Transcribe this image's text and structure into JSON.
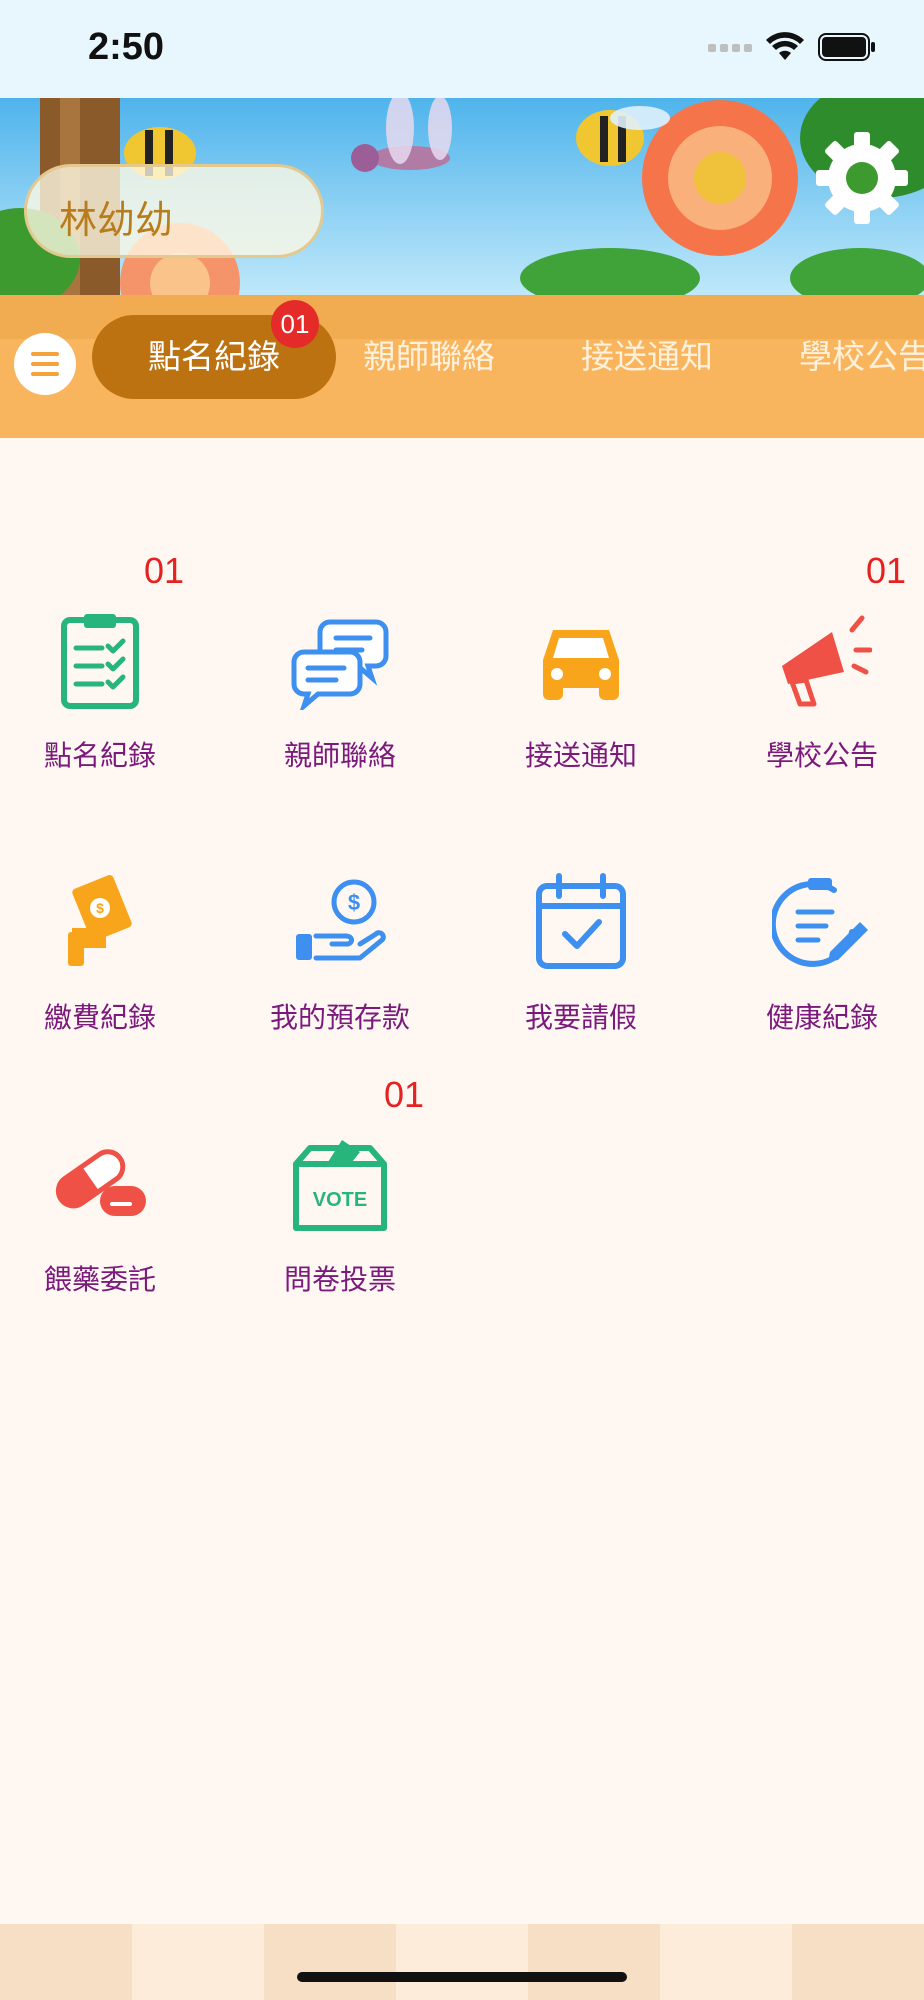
{
  "status_bar": {
    "time": "2:50"
  },
  "profile": {
    "child_name": "林幼幼"
  },
  "tabs": [
    {
      "label": "點名紀錄",
      "badge": "01"
    },
    {
      "label": "親師聯絡"
    },
    {
      "label": "接送通知"
    },
    {
      "label": "學校公告"
    }
  ],
  "grid": [
    {
      "label": "點名紀錄",
      "badge": "01",
      "icon": "clipboard-checklist-icon"
    },
    {
      "label": "親師聯絡",
      "badge": "",
      "icon": "chat-bubbles-icon"
    },
    {
      "label": "接送通知",
      "badge": "",
      "icon": "car-icon"
    },
    {
      "label": "學校公告",
      "badge": "01",
      "icon": "megaphone-icon"
    },
    {
      "label": "繳費紀錄",
      "badge": "",
      "icon": "payment-hand-icon"
    },
    {
      "label": "我的預存款",
      "badge": "",
      "icon": "money-hand-icon"
    },
    {
      "label": "我要請假",
      "badge": "",
      "icon": "calendar-check-icon"
    },
    {
      "label": "健康紀錄",
      "badge": "",
      "icon": "health-note-icon"
    },
    {
      "label": "餵藥委託",
      "badge": "",
      "icon": "pill-icon"
    },
    {
      "label": "問卷投票",
      "badge": "01",
      "icon": "vote-box-icon",
      "vote_text": "VOTE"
    }
  ],
  "colors": {
    "tab_bar": "#f9b55e",
    "active_tab": "#bd7212",
    "label": "#7b1a7d",
    "badge": "#e52222",
    "green": "#27b57c",
    "blue": "#3d8ff0",
    "orange": "#f8a51b",
    "red": "#ef5146"
  }
}
